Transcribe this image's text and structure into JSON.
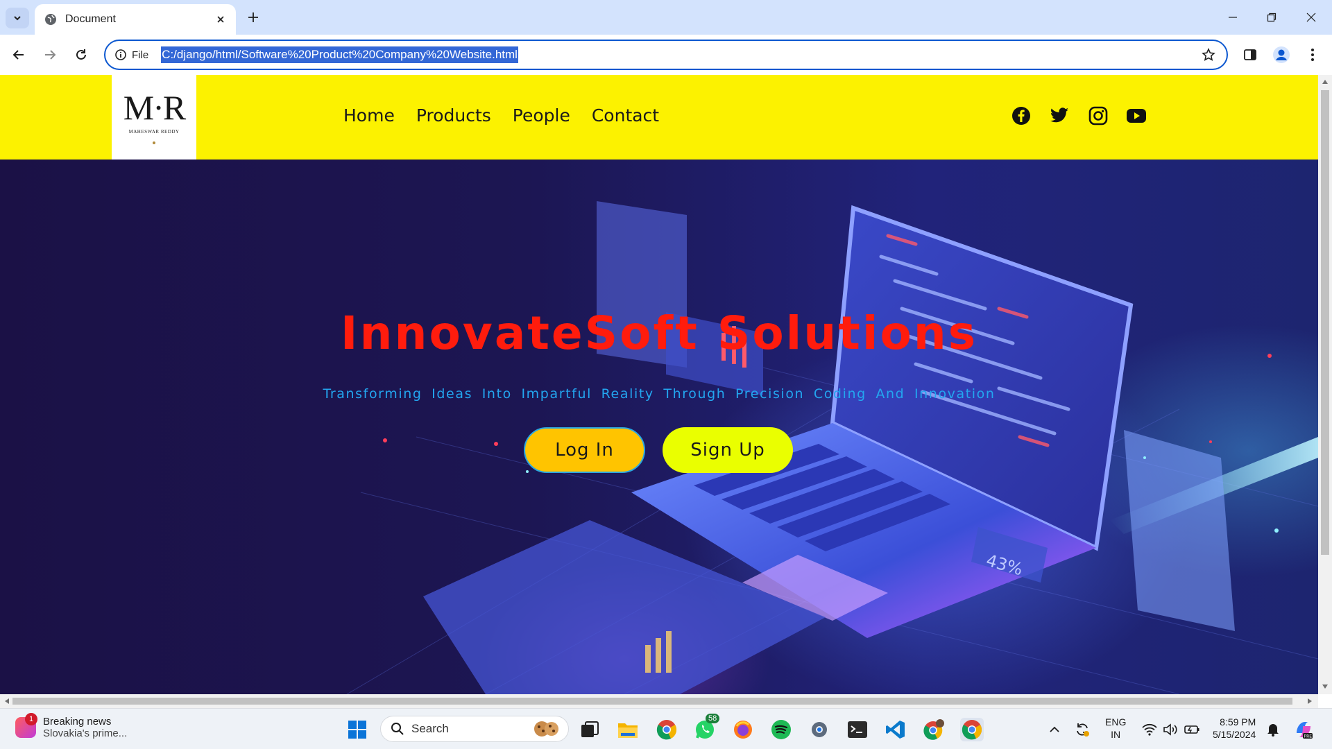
{
  "browser": {
    "tab_title": "Document",
    "omnibox_chip": "File",
    "url": "C:/django/html/Software%20Product%20Company%20Website.html"
  },
  "site": {
    "logo_mark": "M·R",
    "logo_name": "MAHESWAR REDDY",
    "nav": [
      "Home",
      "Products",
      "People",
      "Contact"
    ],
    "social": [
      "facebook-icon",
      "twitter-icon",
      "instagram-icon",
      "youtube-icon"
    ],
    "hero_title": "InnovateSoft Solutions",
    "hero_subtitle": "Transforming Ideas Into Impartful Reality Through Precision Coding And Innovation",
    "login_label": "Log In",
    "signup_label": "Sign Up",
    "colors": {
      "header_bg": "#fcf200",
      "title": "#ff1c0d",
      "subtitle": "#23a6f0",
      "login_bg": "#ffc400",
      "signup_bg": "#eaff00"
    }
  },
  "taskbar": {
    "news_title": "Breaking news",
    "news_sub": "Slovakia's prime...",
    "news_badge": "1",
    "search_placeholder": "Search",
    "whatsapp_badge": "58",
    "lang": "ENG",
    "region": "IN",
    "time": "8:59 PM",
    "date": "5/15/2024"
  }
}
